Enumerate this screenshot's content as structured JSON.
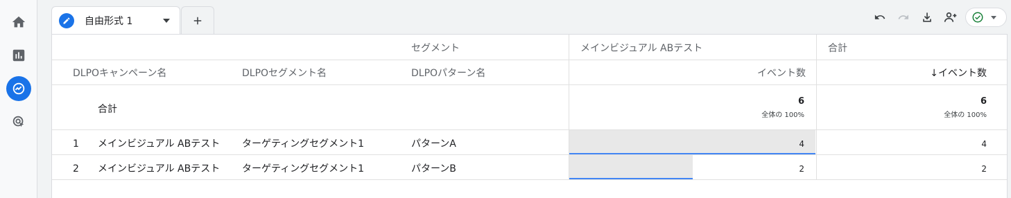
{
  "tabs": {
    "active_label": "自由形式 1"
  },
  "table": {
    "segment_header": "セグメント",
    "group_header": "メインビジュアル ABテスト",
    "total_header": "合計",
    "columns": {
      "campaign": "DLPOキャンペーン名",
      "segment": "DLPOセグメント名",
      "pattern": "DLPOパターン名",
      "events": "イベント数",
      "events_sorted": "↓イベント数"
    },
    "totals": {
      "label": "合計",
      "group_value": "6",
      "group_pct": "全体の 100%",
      "total_value": "6",
      "total_pct": "全体の 100%"
    },
    "rows": [
      {
        "index": "1",
        "campaign": "メインビジュアル ABテスト",
        "segment": "ターゲティングセグメント1",
        "pattern": "パターンA",
        "group_value": "4",
        "total_value": "4",
        "share": 1.0
      },
      {
        "index": "2",
        "campaign": "メインビジュアル ABテスト",
        "segment": "ターゲティングセグメント1",
        "pattern": "パターンB",
        "group_value": "2",
        "total_value": "2",
        "share": 0.5
      }
    ]
  },
  "colors": {
    "accent": "#1a73e8",
    "success": "#188038",
    "bar_fill": "#e8e8e8",
    "bar_line": "#4285f4"
  },
  "icons": [
    "home-icon",
    "reports-icon",
    "explore-icon",
    "advertising-icon",
    "edit-icon",
    "add-icon",
    "undo-icon",
    "redo-icon",
    "download-icon",
    "share-icon",
    "check-circle-icon"
  ]
}
